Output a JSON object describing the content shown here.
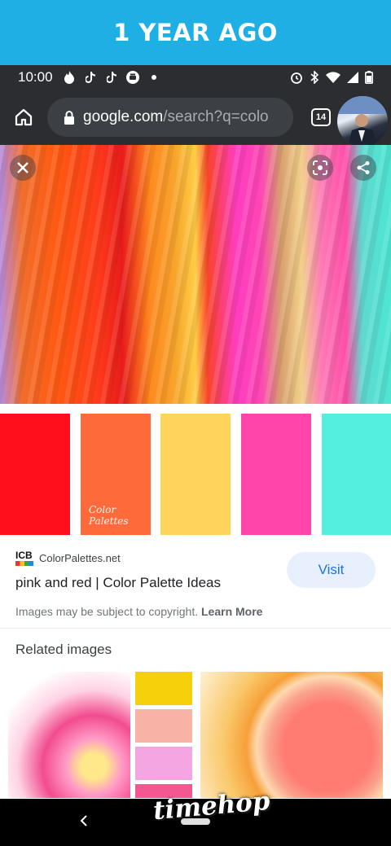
{
  "banner": {
    "title": "1 YEAR AGO",
    "color": "#1eb0e4"
  },
  "status_bar": {
    "time": "10:00",
    "left_icons": [
      "fire-app-icon",
      "tiktok-icon",
      "tiktok-icon",
      "printer-app-icon",
      "dot-icon"
    ],
    "right_icons": [
      "alarm-icon",
      "bluetooth-icon",
      "wifi-icon",
      "signal-icon",
      "battery-icon"
    ]
  },
  "browser": {
    "url_host": "google.com",
    "url_path": "/search?q=colo",
    "tab_count": "14"
  },
  "hero": {
    "swatches": [
      {
        "color": "#ff0f1c",
        "label": ""
      },
      {
        "color": "#ff6a3a",
        "label": "Color\nPalettes"
      },
      {
        "color": "#ffd45a",
        "label": ""
      },
      {
        "color": "#ff45a9",
        "label": ""
      },
      {
        "color": "#55efe0",
        "label": ""
      }
    ]
  },
  "result": {
    "source_name": "ColorPalettes.net",
    "source_logo_text": "ICB",
    "title": "pink and red | Color Palette Ideas",
    "visit_label": "Visit",
    "copyright_text": "Images may be subject to copyright. ",
    "learn_more": "Learn More"
  },
  "related": {
    "heading": "Related images",
    "palette_colors": [
      "#f6d00a",
      "#f8b3a6",
      "#f4a6e2",
      "#f55890"
    ]
  },
  "watermark": "timehop"
}
